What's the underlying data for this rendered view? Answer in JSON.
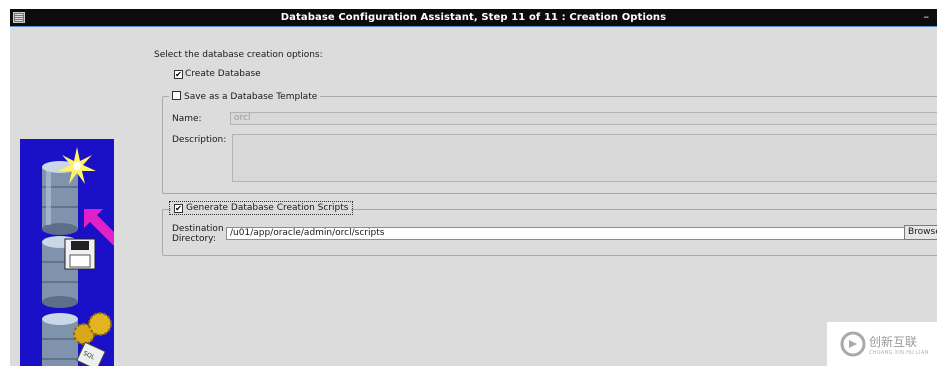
{
  "window": {
    "title": "Database Configuration Assistant, Step 11 of 11 : Creation Options",
    "minimize_glyph": "–"
  },
  "creation": {
    "prompt": "Select the database creation options:",
    "create_database": {
      "label": "Create Database",
      "checked": true
    },
    "save_template": {
      "label": "Save as a Database Template",
      "checked": false,
      "name_label": "Name:",
      "name_value": "orcl",
      "description_label": "Description:",
      "description_value": ""
    },
    "generate_scripts": {
      "label": "Generate Database Creation Scripts",
      "checked": true,
      "destination_label_line1": "Destination",
      "destination_label_line2": "Directory:",
      "destination_value": "/u01/app/oracle/admin/orcl/scripts",
      "browse_label": "Browse"
    }
  },
  "watermark": {
    "text": "创新互联",
    "subtext": "CHUANG XIN HU LIAN"
  },
  "colors": {
    "titlebar": "#0c0c0c",
    "panel": "#dcdcdc",
    "side_art": "#1a10c8",
    "arrow": "#e020c8"
  },
  "icons": [
    "window-menu-icon",
    "database-create-icon",
    "database-template-icon",
    "database-scripts-icon",
    "watermark-logo-icon"
  ]
}
